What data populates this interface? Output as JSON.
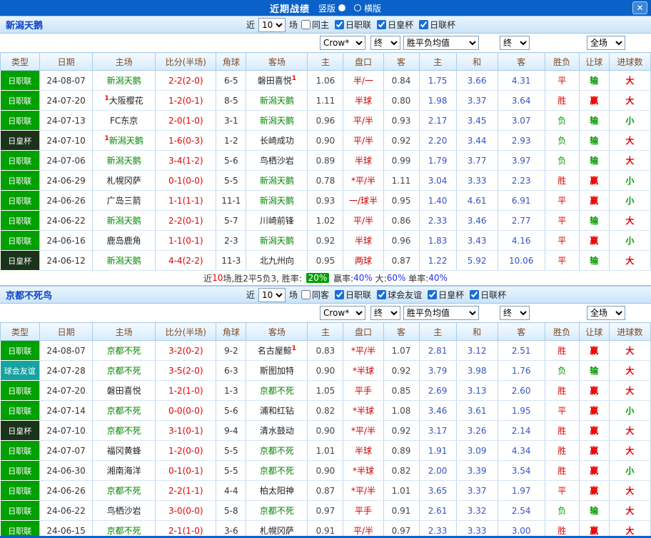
{
  "titlebar": {
    "title": "近期战绩",
    "radio_vertical": "竖版",
    "radio_horizontal": "横版",
    "close": "✕"
  },
  "dropdowns": {
    "company": "Crow*",
    "final1": "终",
    "avg": "胜平负均值",
    "final2": "终",
    "scope": "全场"
  },
  "columns": [
    "类型",
    "日期",
    "主场",
    "比分(半场)",
    "角球",
    "客场",
    "主",
    "盘口",
    "客",
    "主",
    "和",
    "客",
    "胜负",
    "让球",
    "进球数"
  ],
  "palette": {
    "focus_team": "#008800",
    "plain_team": "#222222",
    "score": "#E60000",
    "corners": "#333333",
    "date": "#333333",
    "asian_odds": "#444444",
    "handicap": "#CC0000",
    "euro_odds": "#3355CC",
    "marker": "#FF0000"
  },
  "type_colors": {
    "日职联": "#00A000",
    "日皇杯": "#1A331A",
    "球会友谊": "#17A2A2"
  },
  "result_colors": {
    "胜": "#E60000",
    "平": "#E60000",
    "负": "#009900",
    "赢": "#E60000",
    "输": "#009900",
    "大": "#E60000",
    "小": "#009900"
  },
  "sections": [
    {
      "team": "新潟天鹅",
      "near_label": "近",
      "near_value": "10",
      "games_label": "场",
      "checkboxes": [
        {
          "label": "同主",
          "checked": false
        },
        {
          "label": "日职联",
          "checked": true
        },
        {
          "label": "日皇杯",
          "checked": true
        },
        {
          "label": "日联杯",
          "checked": true
        }
      ],
      "rows": [
        {
          "type": "日职联",
          "date": "24-08-07",
          "home": {
            "name": "新潟天鹅",
            "focus": true
          },
          "score": "2-2(2-0)",
          "corners": "6-5",
          "away": {
            "name": "磐田喜悦",
            "post": "1"
          },
          "h": "1.06",
          "hcap": "半/一",
          "a": "0.84",
          "w": "1.75",
          "d": "3.66",
          "l": "4.31",
          "r1": "平",
          "r2": "输",
          "r3": "大"
        },
        {
          "type": "日职联",
          "date": "24-07-20",
          "home": {
            "pre": "1",
            "name": "大阪樱花"
          },
          "score": "1-2(0-1)",
          "corners": "8-5",
          "away": {
            "name": "新潟天鹅",
            "focus": true
          },
          "h": "1.11",
          "hcap": "半球",
          "a": "0.80",
          "w": "1.98",
          "d": "3.37",
          "l": "3.64",
          "r1": "胜",
          "r2": "赢",
          "r3": "大"
        },
        {
          "type": "日职联",
          "date": "24-07-13",
          "home": {
            "name": "FC东京"
          },
          "score": "2-0(1-0)",
          "corners": "3-1",
          "away": {
            "name": "新潟天鹅",
            "focus": true
          },
          "h": "0.96",
          "hcap": "平/半",
          "a": "0.93",
          "w": "2.17",
          "d": "3.45",
          "l": "3.07",
          "r1": "负",
          "r2": "输",
          "r3": "小"
        },
        {
          "type": "日皇杯",
          "date": "24-07-10",
          "home": {
            "pre": "1",
            "name": "新潟天鹅",
            "focus": true
          },
          "score": "1-6(0-3)",
          "corners": "1-2",
          "away": {
            "name": "长崎成功"
          },
          "h": "0.90",
          "hcap": "平/半",
          "a": "0.92",
          "w": "2.20",
          "d": "3.44",
          "l": "2.93",
          "r1": "负",
          "r2": "输",
          "r3": "大"
        },
        {
          "type": "日职联",
          "date": "24-07-06",
          "home": {
            "name": "新潟天鹅",
            "focus": true
          },
          "score": "3-4(1-2)",
          "corners": "5-6",
          "away": {
            "name": "鸟栖沙岩"
          },
          "h": "0.89",
          "hcap": "半球",
          "a": "0.99",
          "w": "1.79",
          "d": "3.77",
          "l": "3.97",
          "r1": "负",
          "r2": "输",
          "r3": "大"
        },
        {
          "type": "日职联",
          "date": "24-06-29",
          "home": {
            "name": "札幌冈萨"
          },
          "score": "0-1(0-0)",
          "corners": "5-5",
          "away": {
            "name": "新潟天鹅",
            "focus": true
          },
          "h": "0.78",
          "hcap": "*平/半",
          "a": "1.11",
          "w": "3.04",
          "d": "3.33",
          "l": "2.23",
          "r1": "胜",
          "r2": "赢",
          "r3": "小"
        },
        {
          "type": "日职联",
          "date": "24-06-26",
          "home": {
            "name": "广岛三箭"
          },
          "score": "1-1(1-1)",
          "corners": "11-1",
          "away": {
            "name": "新潟天鹅",
            "focus": true
          },
          "h": "0.93",
          "hcap": "一/球半",
          "a": "0.95",
          "w": "1.40",
          "d": "4.61",
          "l": "6.91",
          "r1": "平",
          "r2": "赢",
          "r3": "小"
        },
        {
          "type": "日职联",
          "date": "24-06-22",
          "home": {
            "name": "新潟天鹅",
            "focus": true
          },
          "score": "2-2(0-1)",
          "corners": "5-7",
          "away": {
            "name": "川崎前锋"
          },
          "h": "1.02",
          "hcap": "平/半",
          "a": "0.86",
          "w": "2.33",
          "d": "3.46",
          "l": "2.77",
          "r1": "平",
          "r2": "输",
          "r3": "大"
        },
        {
          "type": "日职联",
          "date": "24-06-16",
          "home": {
            "name": "鹿岛鹿角"
          },
          "score": "1-1(0-1)",
          "corners": "2-3",
          "away": {
            "name": "新潟天鹅",
            "focus": true
          },
          "h": "0.92",
          "hcap": "半球",
          "a": "0.96",
          "w": "1.83",
          "d": "3.43",
          "l": "4.16",
          "r1": "平",
          "r2": "赢",
          "r3": "小"
        },
        {
          "type": "日皇杯",
          "date": "24-06-12",
          "home": {
            "name": "新潟天鹅",
            "focus": true
          },
          "score": "4-4(2-2)",
          "corners": "11-3",
          "away": {
            "name": "北九州向"
          },
          "h": "0.95",
          "hcap": "两球",
          "a": "0.87",
          "w": "1.22",
          "d": "5.92",
          "l": "10.06",
          "r1": "平",
          "r2": "输",
          "r3": "大"
        }
      ],
      "summary": [
        {
          "text": "近",
          "color": "#333333"
        },
        {
          "text": "10",
          "color": "#E60000"
        },
        {
          "text": "场,胜2平5负3, 胜率: ",
          "color": "#333333"
        },
        {
          "text": "20%",
          "color": "#FFFFFF",
          "bg": "#00A000"
        },
        {
          "text": " 赢率:",
          "color": "#333333"
        },
        {
          "text": "40%",
          "color": "#2233EE"
        },
        {
          "text": " 大:",
          "color": "#333333"
        },
        {
          "text": "60%",
          "color": "#2233EE"
        },
        {
          "text": " 单率:",
          "color": "#333333"
        },
        {
          "text": "40%",
          "color": "#2233EE"
        }
      ]
    },
    {
      "team": "京都不死鸟",
      "near_label": "近",
      "near_value": "10",
      "games_label": "场",
      "checkboxes": [
        {
          "label": "同客",
          "checked": false
        },
        {
          "label": "日职联",
          "checked": true
        },
        {
          "label": "球会友谊",
          "checked": true
        },
        {
          "label": "日皇杯",
          "checked": true
        },
        {
          "label": "日联杯",
          "checked": true
        }
      ],
      "rows": [
        {
          "type": "日职联",
          "date": "24-08-07",
          "home": {
            "name": "京都不死",
            "focus": true
          },
          "score": "3-2(0-2)",
          "corners": "9-2",
          "away": {
            "name": "名古屋鲸",
            "post": "1"
          },
          "h": "0.83",
          "hcap": "*平/半",
          "a": "1.07",
          "w": "2.81",
          "d": "3.12",
          "l": "2.51",
          "r1": "胜",
          "r2": "赢",
          "r3": "大"
        },
        {
          "type": "球会友谊",
          "date": "24-07-28",
          "home": {
            "name": "京都不死",
            "focus": true
          },
          "score": "3-5(2-0)",
          "corners": "6-3",
          "away": {
            "name": "斯图加特"
          },
          "h": "0.90",
          "hcap": "*半球",
          "a": "0.92",
          "w": "3.79",
          "d": "3.98",
          "l": "1.76",
          "r1": "负",
          "r2": "输",
          "r3": "大"
        },
        {
          "type": "日职联",
          "date": "24-07-20",
          "home": {
            "name": "磐田喜悦"
          },
          "score": "1-2(1-0)",
          "corners": "1-3",
          "away": {
            "name": "京都不死",
            "focus": true
          },
          "h": "1.05",
          "hcap": "平手",
          "a": "0.85",
          "w": "2.69",
          "d": "3.13",
          "l": "2.60",
          "r1": "胜",
          "r2": "赢",
          "r3": "大"
        },
        {
          "type": "日职联",
          "date": "24-07-14",
          "home": {
            "name": "京都不死",
            "focus": true
          },
          "score": "0-0(0-0)",
          "corners": "5-6",
          "away": {
            "name": "浦和红钻"
          },
          "h": "0.82",
          "hcap": "*半球",
          "a": "1.08",
          "w": "3.46",
          "d": "3.61",
          "l": "1.95",
          "r1": "平",
          "r2": "赢",
          "r3": "小"
        },
        {
          "type": "日皇杯",
          "date": "24-07-10",
          "home": {
            "name": "京都不死",
            "focus": true
          },
          "score": "3-1(0-1)",
          "corners": "9-4",
          "away": {
            "name": "清水鼓动"
          },
          "h": "0.90",
          "hcap": "*平/半",
          "a": "0.92",
          "w": "3.17",
          "d": "3.26",
          "l": "2.14",
          "r1": "胜",
          "r2": "赢",
          "r3": "大"
        },
        {
          "type": "日职联",
          "date": "24-07-07",
          "home": {
            "name": "福冈黄蜂"
          },
          "score": "1-2(0-0)",
          "corners": "5-5",
          "away": {
            "name": "京都不死",
            "focus": true
          },
          "h": "1.01",
          "hcap": "半球",
          "a": "0.89",
          "w": "1.91",
          "d": "3.09",
          "l": "4.34",
          "r1": "胜",
          "r2": "赢",
          "r3": "大"
        },
        {
          "type": "日职联",
          "date": "24-06-30",
          "home": {
            "name": "湘南海洋"
          },
          "score": "0-1(0-1)",
          "corners": "5-5",
          "away": {
            "name": "京都不死",
            "focus": true
          },
          "h": "0.90",
          "hcap": "*半球",
          "a": "0.82",
          "w": "2.00",
          "d": "3.39",
          "l": "3.54",
          "r1": "胜",
          "r2": "赢",
          "r3": "小"
        },
        {
          "type": "日职联",
          "date": "24-06-26",
          "home": {
            "name": "京都不死",
            "focus": true
          },
          "score": "2-2(1-1)",
          "corners": "4-4",
          "away": {
            "name": "柏太阳神"
          },
          "h": "0.87",
          "hcap": "*平/半",
          "a": "1.01",
          "w": "3.65",
          "d": "3.37",
          "l": "1.97",
          "r1": "平",
          "r2": "赢",
          "r3": "大"
        },
        {
          "type": "日职联",
          "date": "24-06-22",
          "home": {
            "name": "鸟栖沙岩"
          },
          "score": "3-0(0-0)",
          "corners": "5-8",
          "away": {
            "name": "京都不死",
            "focus": true
          },
          "h": "0.97",
          "hcap": "平手",
          "a": "0.91",
          "w": "2.61",
          "d": "3.32",
          "l": "2.54",
          "r1": "负",
          "r2": "输",
          "r3": "大"
        },
        {
          "type": "日职联",
          "date": "24-06-15",
          "home": {
            "name": "京都不死",
            "focus": true
          },
          "score": "2-1(1-0)",
          "corners": "3-6",
          "away": {
            "name": "札幌冈萨"
          },
          "h": "0.91",
          "hcap": "平/半",
          "a": "0.97",
          "w": "2.33",
          "d": "3.33",
          "l": "3.00",
          "r1": "胜",
          "r2": "赢",
          "r3": "大"
        }
      ]
    }
  ]
}
